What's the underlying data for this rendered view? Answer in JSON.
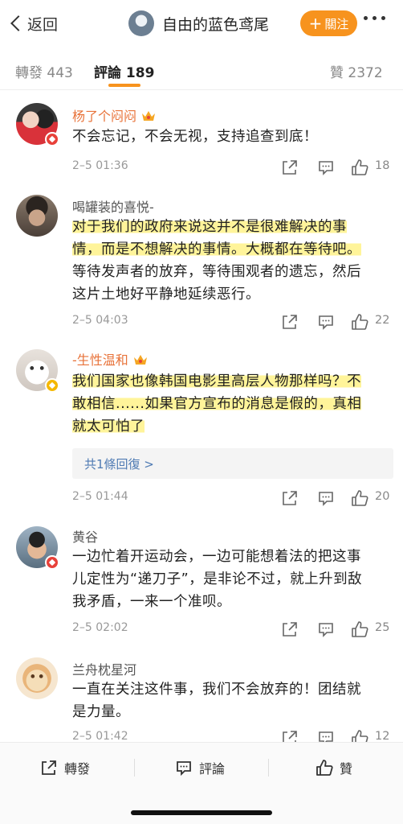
{
  "header": {
    "back_label": "返回",
    "title": "自由的蓝色鸢尾",
    "follow_label": "關注",
    "accent_color": "#f7931e"
  },
  "tabs": [
    {
      "label": "轉發",
      "count": "443"
    },
    {
      "label": "評論",
      "count": "189"
    },
    {
      "label": "贊",
      "count": "2372"
    }
  ],
  "comments": [
    {
      "name": "杨了个闷闷",
      "lines": [
        "不会忘记，不会无视，支持追查到底！"
      ],
      "time": "2–5 01:36",
      "likes": "18"
    },
    {
      "name": "喝罐装的喜悦-",
      "lines": [
        "对于我们的政府来说这并不是很难解决的事",
        "情，而是不想解决的事情。大概都在等待吧。",
        "等待发声者的放弃，等待围观者的遗忘，然后",
        "这片土地好平静地延续恶行。"
      ],
      "time": "2–5 04:03",
      "likes": "22"
    },
    {
      "name": "-生性温和",
      "lines": [
        "我们国家也像韩国电影里高层人物那样吗？不",
        "敢相信......如果官方宣布的消息是假的，真相",
        "就太可怕了"
      ],
      "replies_label": "共1條回復 >",
      "time": "2–5 01:44",
      "likes": "20"
    },
    {
      "name": "黄谷",
      "lines": [
        "一边忙着开运动会，一边可能想着法的把这事",
        "儿定性为“递刀子”，是非论不过，就上升到敌",
        "我矛盾，一来一个准呗。"
      ],
      "time": "2–5 02:02",
      "likes": "25"
    },
    {
      "name": "兰舟枕星河",
      "lines": [
        "一直在关注这件事，我们不会放弃的！团结就",
        "是力量。"
      ],
      "time": "2–5 01:42",
      "likes": "12"
    }
  ],
  "bottom_bar": {
    "repost_label": "轉發",
    "comment_label": "評論",
    "like_label": "贊"
  },
  "icons": [
    "chevron-left-icon",
    "more-icon",
    "share-icon",
    "reply-icon",
    "like-icon",
    "crown-icon",
    "verified-icon"
  ]
}
